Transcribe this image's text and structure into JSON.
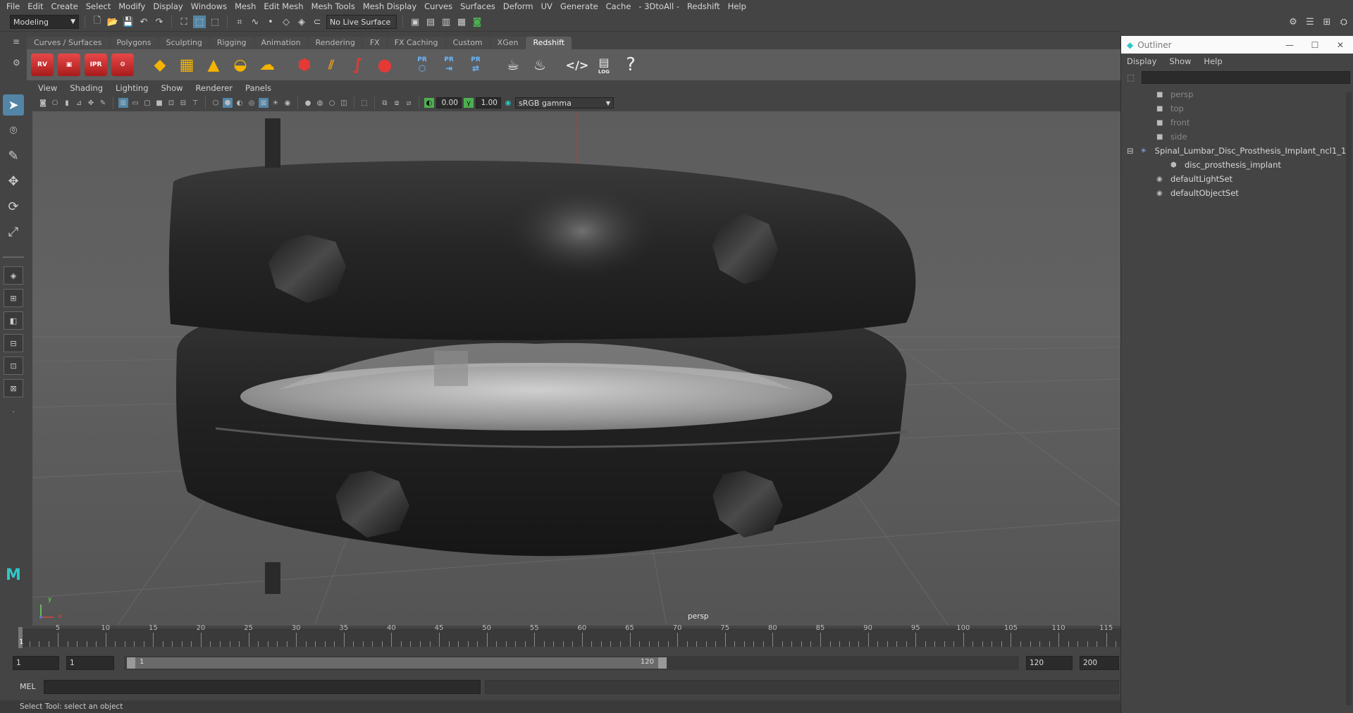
{
  "menubar": [
    "File",
    "Edit",
    "Create",
    "Select",
    "Modify",
    "Display",
    "Windows",
    "Mesh",
    "Edit Mesh",
    "Mesh Tools",
    "Mesh Display",
    "Curves",
    "Surfaces",
    "Deform",
    "UV",
    "Generate",
    "Cache",
    "- 3DtoAll -",
    "Redshift",
    "Help"
  ],
  "status": {
    "workspace": "Modeling",
    "live_surface": "No Live Surface"
  },
  "shelf_tabs": [
    "Curves / Surfaces",
    "Polygons",
    "Sculpting",
    "Rigging",
    "Animation",
    "Rendering",
    "FX",
    "FX Caching",
    "Custom",
    "XGen",
    "Redshift"
  ],
  "shelf_active_tab": "Redshift",
  "shelf": {
    "rv": "RV",
    "ipr": "IPR",
    "pr1": "PR",
    "pr2": "PR",
    "pr3": "PR",
    "log": "LOG",
    "help": "?"
  },
  "viewport": {
    "menus": [
      "View",
      "Shading",
      "Lighting",
      "Show",
      "Renderer",
      "Panels"
    ],
    "exposure": "0.00",
    "gamma": "1.00",
    "color_space": "sRGB gamma",
    "camera_label": "persp",
    "axis_y": "y",
    "axis_x": "x"
  },
  "outliner": {
    "title": "Outliner",
    "menus": [
      "Display",
      "Show",
      "Help"
    ],
    "items": [
      {
        "label": "persp",
        "dim": true,
        "icon": "camera-icon"
      },
      {
        "label": "top",
        "dim": true,
        "icon": "camera-icon"
      },
      {
        "label": "front",
        "dim": true,
        "icon": "camera-icon"
      },
      {
        "label": "side",
        "dim": true,
        "icon": "camera-icon"
      },
      {
        "label": "Spinal_Lumbar_Disc_Prosthesis_Implant_ncl1_1",
        "dim": false,
        "icon": "group-icon"
      },
      {
        "label": "disc_prosthesis_implant",
        "dim": false,
        "icon": "mesh-icon"
      },
      {
        "label": "defaultLightSet",
        "dim": false,
        "icon": "set-icon"
      },
      {
        "label": "defaultObjectSet",
        "dim": false,
        "icon": "set-icon"
      }
    ]
  },
  "timeline": {
    "ticks": [
      "5",
      "10",
      "15",
      "20",
      "25",
      "30",
      "35",
      "40",
      "45",
      "50",
      "55",
      "60",
      "65",
      "70",
      "75",
      "80",
      "85",
      "90",
      "95",
      "100",
      "105",
      "110",
      "115"
    ],
    "current_frame": "1"
  },
  "range": {
    "start": "1",
    "current": "1",
    "slider_start": "1",
    "slider_end": "120",
    "end": "120",
    "max": "200"
  },
  "cmdline": {
    "lang": "MEL"
  },
  "helpline": "Select Tool: select an object",
  "colors": {
    "accent": "#5285a6",
    "redshift": "#d32f2f",
    "bg": "#444444",
    "viewport": "#5f5f5f"
  }
}
